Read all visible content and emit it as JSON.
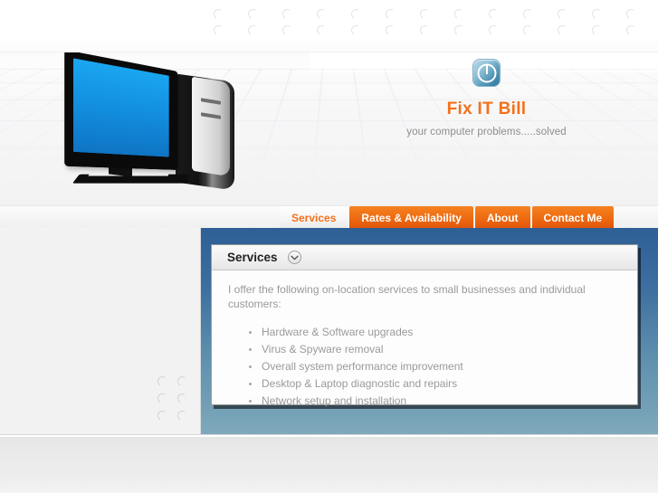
{
  "site": {
    "brand_title": "Fix IT Bill",
    "tagline": "your computer problems.....solved",
    "brand_color": "#f4701b",
    "logo_icon": "power-button-icon"
  },
  "decor": {
    "top_dot_columns": 13,
    "top_dot_rows": 2,
    "sidebar_dot_columns": 2,
    "sidebar_dot_rows": 3,
    "hero_illustration": "desktop-computer-illustration",
    "panel_gradient_top": "#2e5f96",
    "panel_gradient_bottom": "#7fa9bb",
    "sidebar_color": "#f2f2f2"
  },
  "nav": {
    "tabs": [
      {
        "label": "Services",
        "active": true
      },
      {
        "label": "Rates & Availability",
        "active": false
      },
      {
        "label": "About",
        "active": false
      },
      {
        "label": "Contact Me",
        "active": false
      }
    ]
  },
  "content": {
    "panel_title": "Services",
    "collapse_icon": "chevron-down-icon",
    "intro": "I offer the following on-location services to small businesses and individual customers:",
    "services": [
      "Hardware & Software upgrades",
      "Virus & Spyware removal",
      "Overall system performance improvement",
      "Desktop & Laptop diagnostic and repairs",
      "Network setup and installation"
    ]
  }
}
